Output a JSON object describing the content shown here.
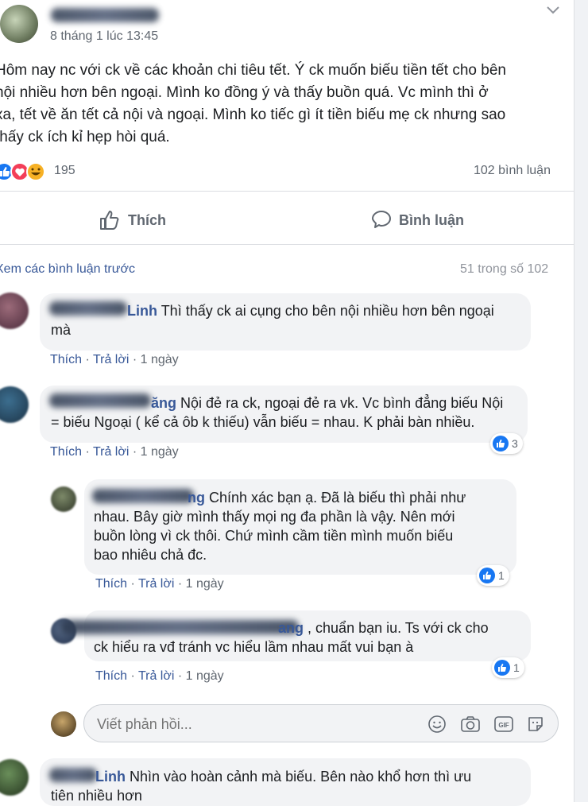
{
  "post": {
    "timestamp": "8 tháng 1 lúc 13:45",
    "text_lines": [
      "Hôm nay nc với ck về các khoản chi tiêu tết. Ý ck muốn biếu tiền tết cho bên",
      "nội nhiều hơn bên ngoại. Mình ko đồng ý và thấy buồn quá. Vc mình thì ở",
      "xa, tết về ăn tết cả nội và ngoại. Mình ko tiếc gì ít tiền biếu mẹ ck nhưng sao",
      "thấy ck ích kỉ hẹp hòi quá."
    ],
    "reaction_count": "195",
    "comment_count": "102 bình luận"
  },
  "actions": {
    "like_label": "Thích",
    "comment_label": "Bình luận"
  },
  "comments_header": {
    "view_previous": "Xem các bình luận trước",
    "count": "51 trong số 102"
  },
  "comments": [
    {
      "name_suffix": "Linh",
      "text_first": "Thì thấy ck ai cụng cho bên nội nhiều hơn bên ngoại",
      "text_rest": "mà",
      "like": "Thích",
      "reply": "Trả lời",
      "time": "1 ngày"
    },
    {
      "name_suffix": "ăng",
      "text_first": "Nội đẻ ra ck, ngoại đẻ ra vk. Vc bình đẳng biếu Nội",
      "text_rest": "= biếu Ngoại ( kể cả ôb k thiếu) vẫn biếu = nhau. K phải bàn nhiều.",
      "like": "Thích",
      "reply": "Trả lời",
      "time": "1 ngày",
      "reactions": "3"
    }
  ],
  "replies": [
    {
      "name_suffix": "ng",
      "line1": "Chính xác bạn ạ. Đã là biếu thì phải như",
      "line2": "nhau. Bây giờ mình thấy mọi ng đa phần là vậy. Nên mới",
      "line3": "buồn lòng vì ck thôi. Chứ mình cầm tiền mình muốn biếu",
      "line4": "bao nhiêu chả đc.",
      "like": "Thích",
      "reply": "Trả lời",
      "time": "1 ngày",
      "reactions": "1"
    },
    {
      "name_suffix": "ang",
      "line1": ", chuẩn bạn iu. Ts với ck cho",
      "line2": "ck hiểu ra vđ tránh vc hiểu lầm nhau mất vui bạn à",
      "like": "Thích",
      "reply": "Trả lời",
      "time": "1 ngày",
      "reactions": "1"
    }
  ],
  "reply_input": {
    "placeholder": "Viết phản hồi..."
  },
  "last_comment": {
    "name_suffix": "Linh",
    "line1": "Nhìn vào hoàn cảnh mà biếu. Bên nào khổ hơn thì ưu",
    "line2": "tiên nhiều hơn"
  },
  "colors": {
    "link": "#385898",
    "like_blue": "#1877f2",
    "bubble": "#f2f3f5"
  }
}
